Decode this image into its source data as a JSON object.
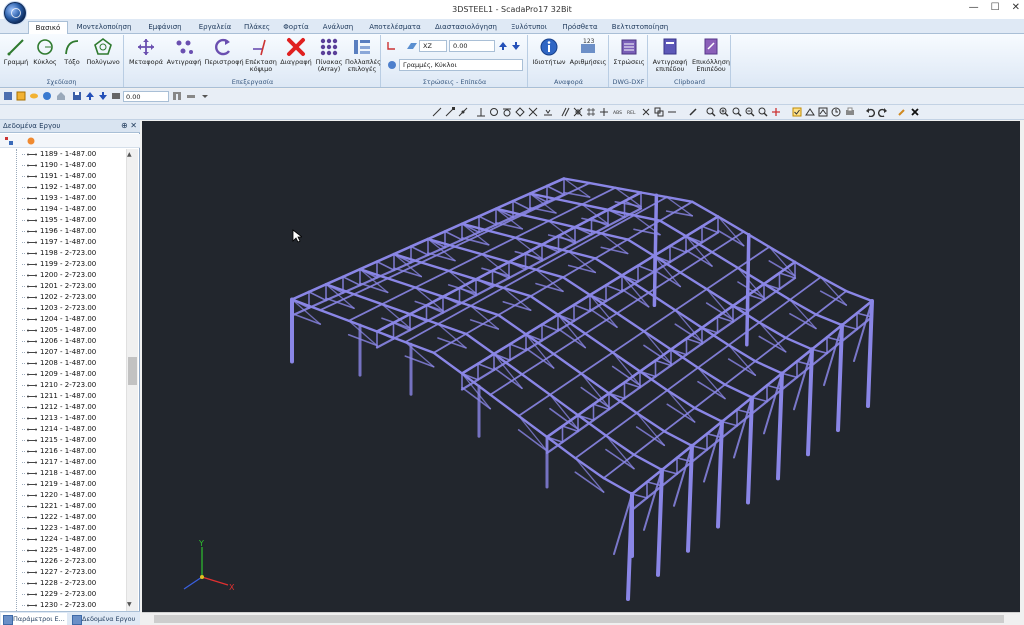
{
  "window": {
    "title": "3DSTEEL1 - ScadaPro17 32Bit",
    "controls": {
      "minimize": "—",
      "maximize": "☐",
      "close": "✕"
    }
  },
  "tabs": [
    "Βασικό",
    "Μοντελοποίηση",
    "Εμφάνιση",
    "Εργαλεία",
    "Πλάκες",
    "Φορτία",
    "Ανάλυση",
    "Αποτελέσματα",
    "Διαστασιολόγηση",
    "Ξυλότυποι",
    "Πρόσθετα",
    "Βελτιστοποίηση"
  ],
  "active_tab": "Βασικό",
  "ribbon": {
    "drawing": {
      "label": "Σχεδίαση",
      "buttons": [
        "Γραμμή",
        "Κύκλος",
        "Τόξο",
        "Πολύγωνο"
      ]
    },
    "editing": {
      "label": "Επεξεργασία",
      "buttons": [
        "Μεταφορά",
        "Αντιγραφή",
        "Περιστροφή",
        "Επέκταση κόψιμο",
        "Διαγραφή",
        "Πίνακας (Array)",
        "Πολλαπλές επιλογές"
      ]
    },
    "layers": {
      "label": "Στρώσεις - Επίπεδα",
      "plane": "XZ",
      "elevation": "0.00",
      "layer": "Γραμμές, Κύκλοι"
    },
    "reference": {
      "label": "Αναφορά",
      "buttons": [
        "Ιδιοτήτων",
        "Αριθμήσεις"
      ]
    },
    "dwg": {
      "label": "DWG-DXF",
      "buttons": [
        "Στρώσεις"
      ]
    },
    "clipboard": {
      "label": "Clipboard",
      "buttons": [
        "Αντιγραφή επιπέδου",
        "Επικόλληση Επιπέδου"
      ]
    }
  },
  "toolbar": {
    "elevation": "0.00"
  },
  "panel": {
    "title": "Δεδομένα Εργου",
    "pin": "⊕ ✕",
    "tree": [
      "1189 - 1-487.00",
      "1190 - 1-487.00",
      "1191 - 1-487.00",
      "1192 - 1-487.00",
      "1193 - 1-487.00",
      "1194 - 1-487.00",
      "1195 - 1-487.00",
      "1196 - 1-487.00",
      "1197 - 1-487.00",
      "1198 - 2-723.00",
      "1199 - 2-723.00",
      "1200 - 2-723.00",
      "1201 - 2-723.00",
      "1202 - 2-723.00",
      "1203 - 2-723.00",
      "1204 - 1-487.00",
      "1205 - 1-487.00",
      "1206 - 1-487.00",
      "1207 - 1-487.00",
      "1208 - 1-487.00",
      "1209 - 1-487.00",
      "1210 - 2-723.00",
      "1211 - 1-487.00",
      "1212 - 1-487.00",
      "1213 - 1-487.00",
      "1214 - 1-487.00",
      "1215 - 1-487.00",
      "1216 - 1-487.00",
      "1217 - 1-487.00",
      "1218 - 1-487.00",
      "1219 - 1-487.00",
      "1220 - 1-487.00",
      "1221 - 1-487.00",
      "1222 - 1-487.00",
      "1223 - 1-487.00",
      "1224 - 1-487.00",
      "1225 - 1-487.00",
      "1226 - 2-723.00",
      "1227 - 2-723.00",
      "1228 - 2-723.00",
      "1229 - 2-723.00",
      "1230 - 2-723.00"
    ],
    "bottom_tabs": [
      "Παράμετροι Ε...",
      "Δεδομένα Εργου"
    ]
  },
  "axes": {
    "y": "Y",
    "x": "X"
  },
  "colors": {
    "model": "#8a86e6",
    "viewport_bg": "#22262d",
    "ribbon_bg": "#dde8f5"
  }
}
